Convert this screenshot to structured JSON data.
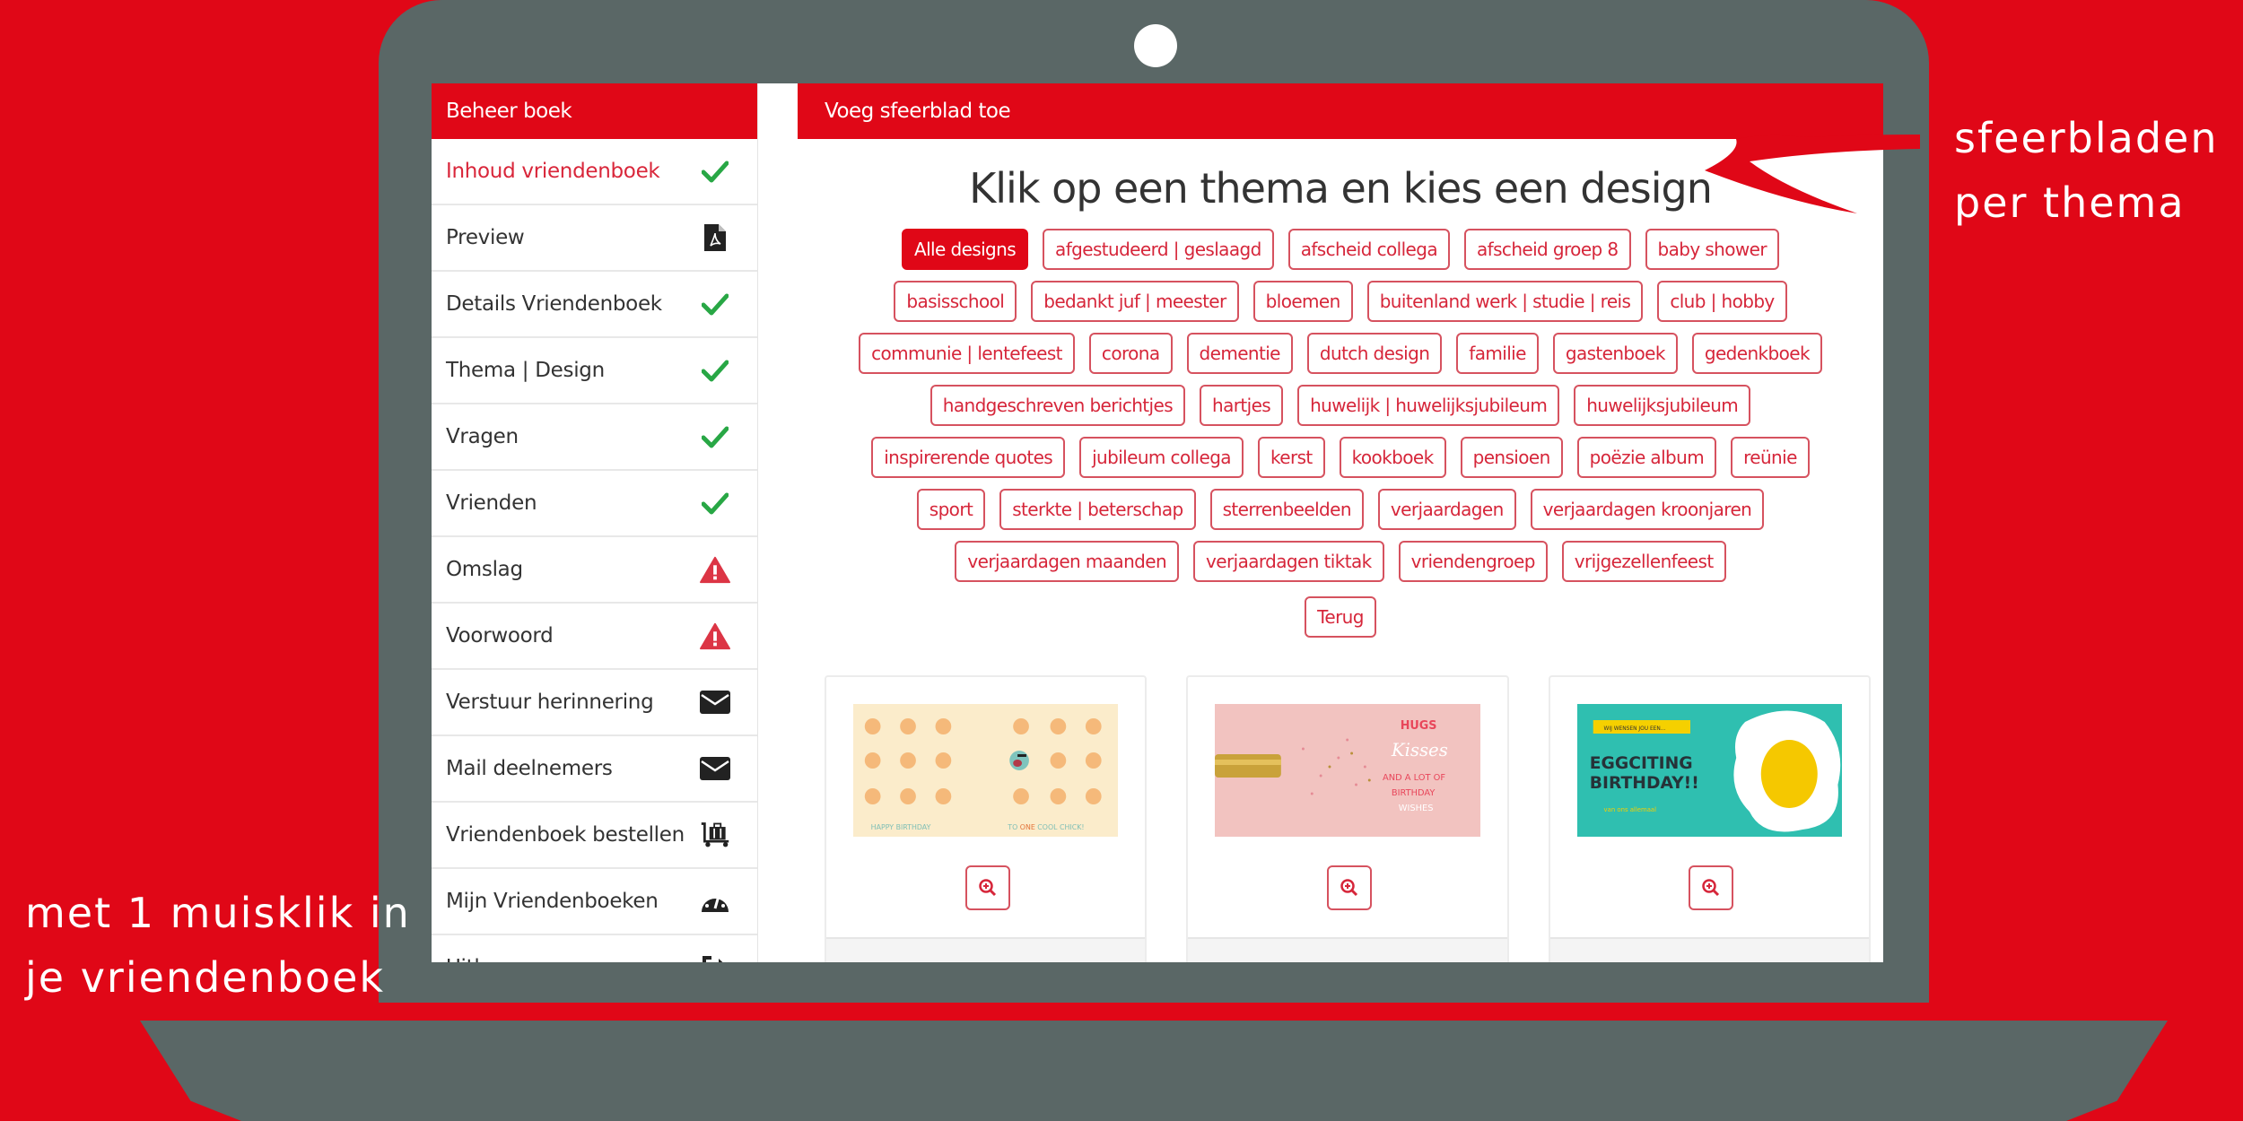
{
  "annotations": {
    "right": [
      "sfeerbladen",
      "per thema"
    ],
    "left": [
      "met 1 muisklik in",
      "je vriendenboek"
    ]
  },
  "colors": {
    "brand_red": "#e00717",
    "frame_gray": "#5a6766",
    "check_green": "#28a745",
    "warning_red": "#dc3545"
  },
  "sidebar": {
    "title": "Beheer boek",
    "items": [
      {
        "label": "Inhoud vriendenboek",
        "icon": "check-icon",
        "active": true
      },
      {
        "label": "Preview",
        "icon": "pdf-file-icon"
      },
      {
        "label": "Details Vriendenboek",
        "icon": "check-icon"
      },
      {
        "label": "Thema | Design",
        "icon": "check-icon"
      },
      {
        "label": "Vragen",
        "icon": "check-icon"
      },
      {
        "label": "Vrienden",
        "icon": "check-icon"
      },
      {
        "label": "Omslag",
        "icon": "warning-icon"
      },
      {
        "label": "Voorwoord",
        "icon": "warning-icon"
      },
      {
        "label": "Verstuur herinnering",
        "icon": "envelope-icon"
      },
      {
        "label": "Mail deelnemers",
        "icon": "envelope-icon"
      },
      {
        "label": "Vriendenboek bestellen",
        "icon": "luggage-cart-icon"
      },
      {
        "label": "Mijn Vriendenboeken",
        "icon": "dashboard-icon"
      },
      {
        "label": "Uitloggen",
        "icon": "sign-out-icon"
      }
    ]
  },
  "main": {
    "header": "Voeg sfeerblad toe",
    "title": "Klik op een thema en kies een design",
    "tags": [
      "Alle designs",
      "afgestudeerd | geslaagd",
      "afscheid collega",
      "afscheid groep 8",
      "baby shower",
      "basisschool",
      "bedankt juf | meester",
      "bloemen",
      "buitenland werk | studie | reis",
      "club | hobby",
      "communie | lentefeest",
      "corona",
      "dementie",
      "dutch design",
      "familie",
      "gastenboek",
      "gedenkboek",
      "handgeschreven berichtjes",
      "hartjes",
      "huwelijk | huwelijksjubileum",
      "huwelijksjubileum",
      "inspirerende quotes",
      "jubileum collega",
      "kerst",
      "kookboek",
      "pensioen",
      "poëzie album",
      "reünie",
      "sport",
      "sterkte | beterschap",
      "sterrenbeelden",
      "verjaardagen",
      "verjaardagen kroonjaren",
      "verjaardagen maanden",
      "verjaardagen tiktak",
      "vriendengroep",
      "vrijgezellenfeest"
    ],
    "active_tag": "Alle designs",
    "back_label": "Terug",
    "designs": [
      {
        "name": "chicks-birthday",
        "text_left": "HAPPY BIRTHDAY",
        "text_right_1": "TO ",
        "text_right_em": "ONE",
        "text_right_2": " COOL CHICK!"
      },
      {
        "name": "champagne-birthday",
        "line1": "HUGS",
        "line2": "Kisses",
        "line3": "AND A LOT OF",
        "line4": "BIRTHDAY",
        "line5": "WISHES"
      },
      {
        "name": "egg-birthday",
        "banner": "WIJ WENSEN JOU EEN...",
        "line1": "EGGCITING",
        "line2": "BIRTHDAY!!",
        "sub": "van ons allemaal"
      }
    ]
  }
}
